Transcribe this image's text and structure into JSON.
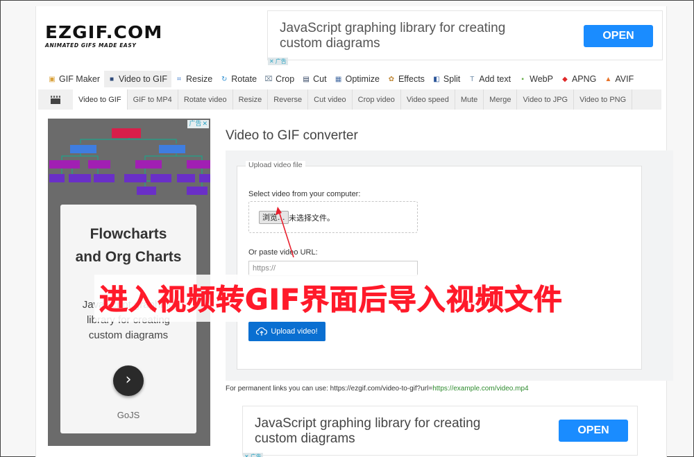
{
  "logo": {
    "main": "EZGIF.COM",
    "tagline": "ANIMATED GIFS MADE EASY"
  },
  "ad_top": {
    "text": "JavaScript graphing library for creating custom diagrams",
    "button": "OPEN",
    "mark_close": "✕",
    "mark_label": "广告"
  },
  "ad_bottom": {
    "text": "JavaScript graphing library for creating custom diagrams",
    "button": "OPEN",
    "mark_close": "✕",
    "mark_label": "广告"
  },
  "main_nav": [
    {
      "label": "GIF Maker",
      "icon": "gif-maker-icon",
      "glyph": "▣",
      "color": "#d9a13b"
    },
    {
      "label": "Video to GIF",
      "icon": "video-icon",
      "glyph": "■",
      "color": "#2e4a7a",
      "active": true
    },
    {
      "label": "Resize",
      "icon": "resize-icon",
      "glyph": "⌗",
      "color": "#3a78c9"
    },
    {
      "label": "Rotate",
      "icon": "rotate-icon",
      "glyph": "↻",
      "color": "#2e8fd1"
    },
    {
      "label": "Crop",
      "icon": "crop-icon",
      "glyph": "⌧",
      "color": "#6a7f93"
    },
    {
      "label": "Cut",
      "icon": "cut-icon",
      "glyph": "▤",
      "color": "#2b3d5c"
    },
    {
      "label": "Optimize",
      "icon": "optimize-icon",
      "glyph": "▦",
      "color": "#4a6fa5"
    },
    {
      "label": "Effects",
      "icon": "effects-icon",
      "glyph": "✿",
      "color": "#c08a3b"
    },
    {
      "label": "Split",
      "icon": "split-icon",
      "glyph": "◧",
      "color": "#2c5699"
    },
    {
      "label": "Add text",
      "icon": "add-text-icon",
      "glyph": "T",
      "color": "#6b8aa8"
    },
    {
      "label": "WebP",
      "icon": "webp-icon",
      "glyph": "▪",
      "color": "#6ab04c"
    },
    {
      "label": "APNG",
      "icon": "apng-icon",
      "glyph": "◆",
      "color": "#e02828"
    },
    {
      "label": "AVIF",
      "icon": "avif-icon",
      "glyph": "▲",
      "color": "#e8742a"
    }
  ],
  "sub_nav": [
    {
      "label": "Video to GIF",
      "active": true
    },
    {
      "label": "GIF to MP4"
    },
    {
      "label": "Rotate video"
    },
    {
      "label": "Resize"
    },
    {
      "label": "Reverse"
    },
    {
      "label": "Cut video"
    },
    {
      "label": "Crop video"
    },
    {
      "label": "Video speed"
    },
    {
      "label": "Mute"
    },
    {
      "label": "Merge"
    },
    {
      "label": "Video to JPG"
    },
    {
      "label": "Video to PNG"
    }
  ],
  "side_ad": {
    "mark_label": "广告",
    "mark_close": "✕",
    "title_line1": "Flowcharts",
    "title_line2": "and Org Charts",
    "desc": "JavaScript graphing library for creating custom diagrams",
    "button_glyph": "›",
    "brand": "GoJS"
  },
  "main": {
    "title": "Video to GIF converter",
    "fieldset_legend": "Upload video file",
    "select_label": "Select video from your computer:",
    "browse_button": "浏览...",
    "file_status": "未选择文件。",
    "url_label": "Or paste video URL:",
    "url_placeholder": "https://",
    "url_value": "",
    "upload_button": "Upload video!",
    "perm_prefix": "For permanent links you can use: https://ezgif.com/video-to-gif?url=",
    "perm_example": "https://example.com/video.mp4"
  },
  "annotation": {
    "text": "进入视频转GIF界面后导入视频文件",
    "color": "#ff1a2a"
  }
}
